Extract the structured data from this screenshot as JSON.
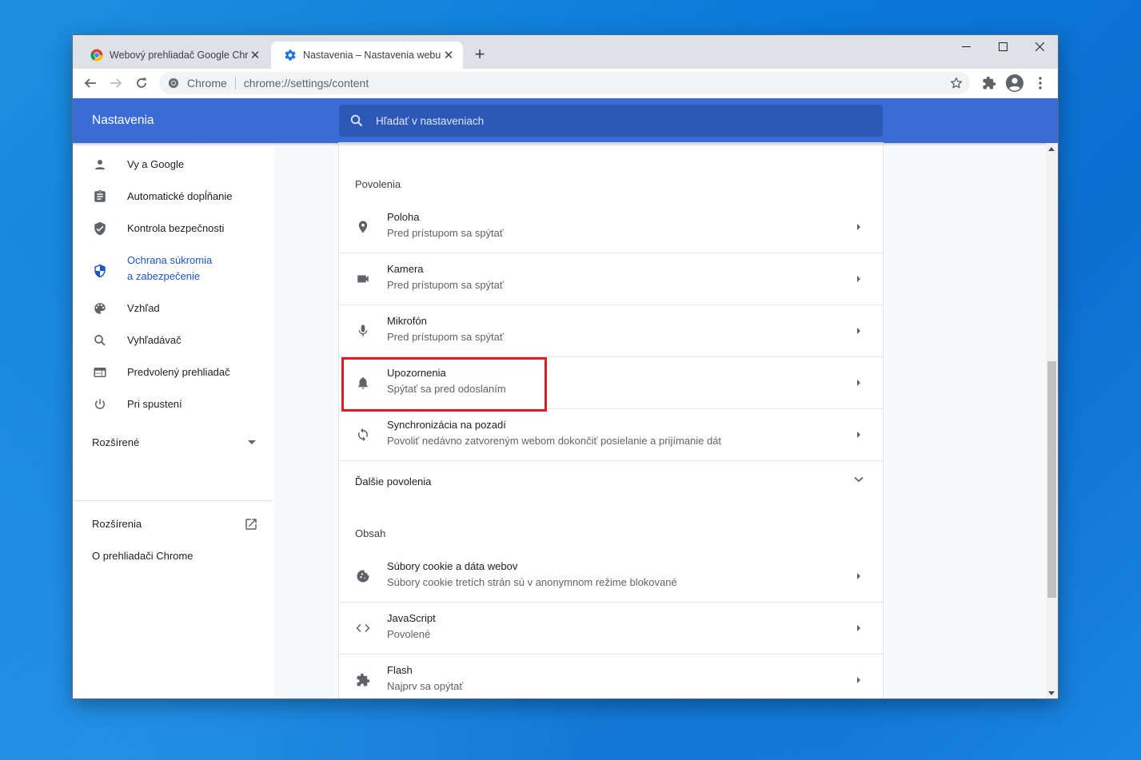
{
  "browser": {
    "tabs": [
      {
        "title": "Webový prehliadač Google Chrome",
        "active": false,
        "icon": "chrome-logo-icon"
      },
      {
        "title": "Nastavenia – Nastavenia webu",
        "active": true,
        "icon": "gear-icon"
      }
    ],
    "omnibox": {
      "chip": "Chrome",
      "url": "chrome://settings/content"
    }
  },
  "header": {
    "title": "Nastavenia",
    "search_placeholder": "Hľadať v nastaveniach"
  },
  "sidebar": {
    "items": [
      {
        "label": "Vy a Google",
        "icon": "person-icon"
      },
      {
        "label": "Automatické dopĺňanie",
        "icon": "clipboard-icon"
      },
      {
        "label": "Kontrola bezpečnosti",
        "icon": "shield-check-icon"
      },
      {
        "label_line1": "Ochrana súkromia",
        "label_line2": "a zabezpečenie",
        "icon": "shield-icon",
        "selected": true
      },
      {
        "label": "Vzhľad",
        "icon": "palette-icon"
      },
      {
        "label": "Vyhľadávač",
        "icon": "search-icon"
      },
      {
        "label": "Predvolený prehliadač",
        "icon": "browser-window-icon"
      },
      {
        "label": "Pri spustení",
        "icon": "power-icon"
      }
    ],
    "advanced": "Rozšírené",
    "extensions": "Rozšírenia",
    "about": "O prehliadači Chrome"
  },
  "permissions": {
    "heading": "Povolenia",
    "rows": [
      {
        "title": "Poloha",
        "subtitle": "Pred prístupom sa spýtať",
        "icon": "location-pin-icon"
      },
      {
        "title": "Kamera",
        "subtitle": "Pred prístupom sa spýtať",
        "icon": "camera-icon"
      },
      {
        "title": "Mikrofón",
        "subtitle": "Pred prístupom sa spýtať",
        "icon": "microphone-icon"
      },
      {
        "title": "Upozornenia",
        "subtitle": "Spýtať sa pred odoslaním",
        "icon": "bell-icon",
        "highlighted": true
      },
      {
        "title": "Synchronizácia na pozadí",
        "subtitle": "Povoliť nedávno zatvoreným webom dokončiť posielanie a prijímanie dát",
        "icon": "sync-icon"
      }
    ],
    "more": "Ďalšie povolenia"
  },
  "content": {
    "heading": "Obsah",
    "rows": [
      {
        "title": "Súbory cookie a dáta webov",
        "subtitle": "Súbory cookie tretích strán sú v anonymnom režime blokované",
        "icon": "cookie-icon"
      },
      {
        "title": "JavaScript",
        "subtitle": "Povolené",
        "icon": "code-icon"
      },
      {
        "title": "Flash",
        "subtitle": "Najprv sa opýtať",
        "icon": "puzzle-icon"
      }
    ]
  },
  "colors": {
    "header": "#3b6cd6",
    "search": "#2d58b5",
    "selected": "#1a56c5",
    "highlight_box": "#d81f26"
  }
}
